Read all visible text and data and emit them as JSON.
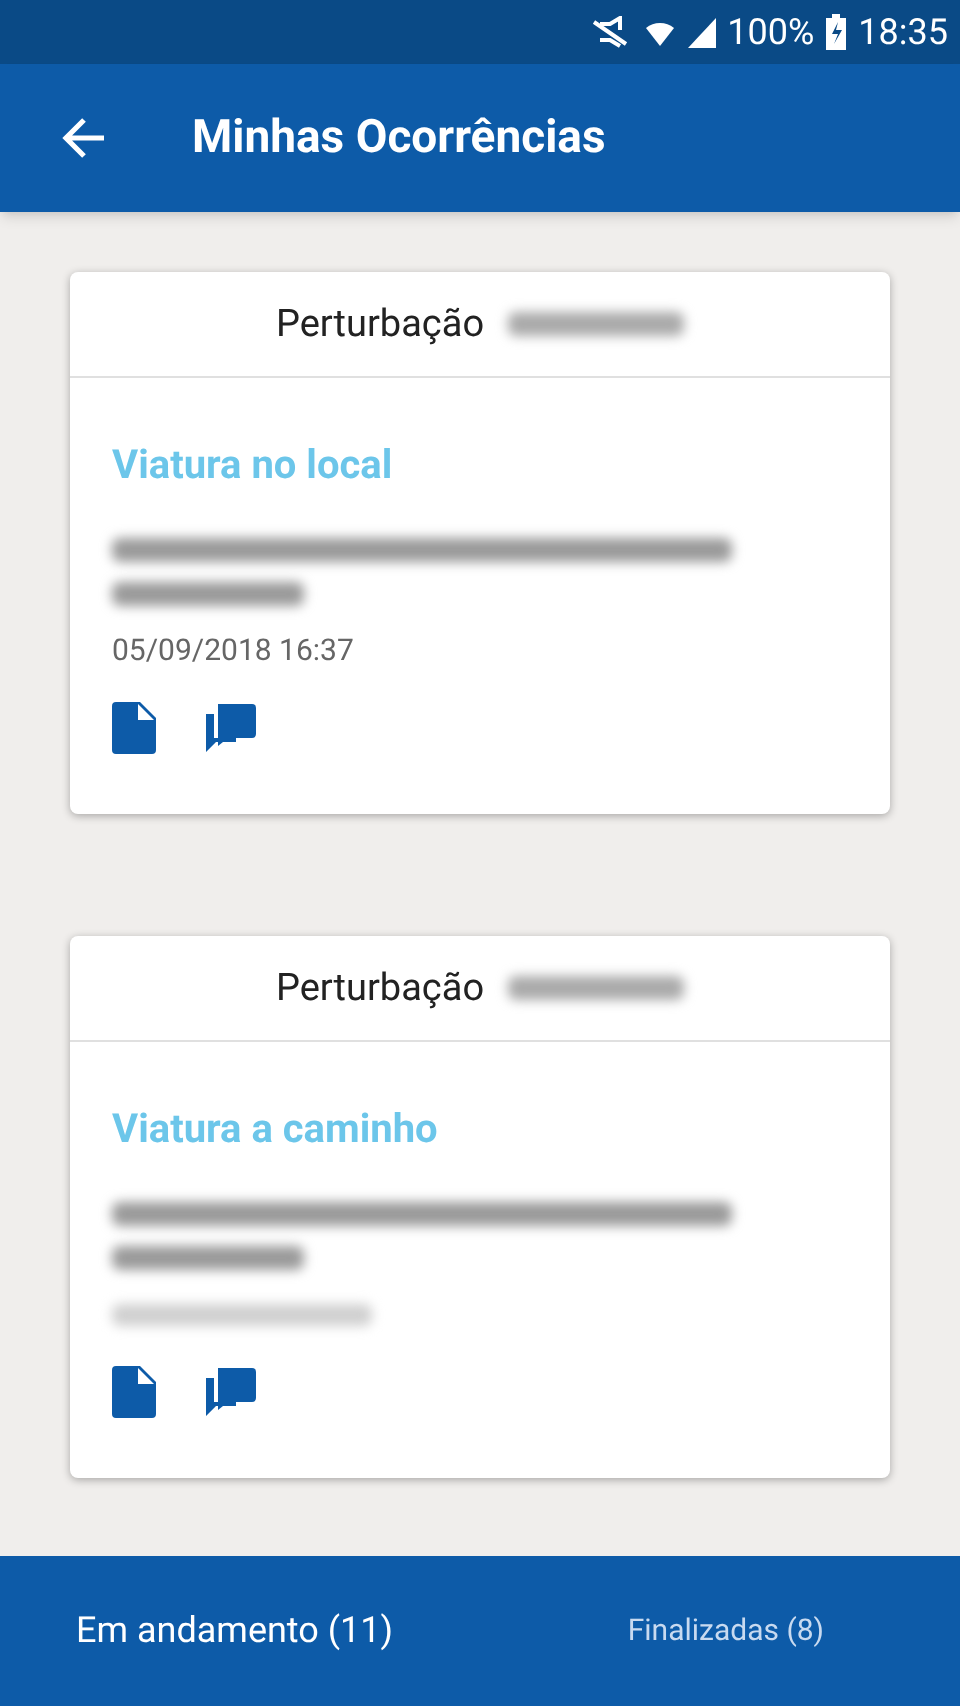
{
  "status_bar": {
    "battery": "100%",
    "time": "18:35"
  },
  "app_bar": {
    "title": "Minhas Ocorrências"
  },
  "cards": [
    {
      "title": "Perturbação",
      "status": "Viatura no local",
      "date": "05/09/2018 16:37"
    },
    {
      "title": "Perturbação",
      "status": "Viatura a caminho"
    }
  ],
  "tabs": [
    {
      "label": "Em andamento (11)",
      "selected": true
    },
    {
      "label": "Finalizadas (8)",
      "selected": false
    }
  ]
}
